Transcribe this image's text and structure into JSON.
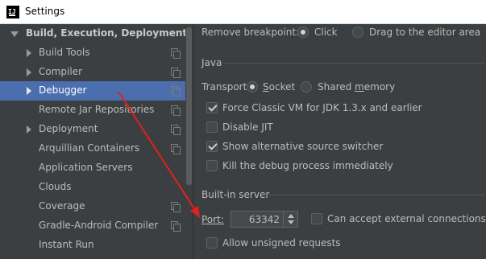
{
  "window": {
    "title": "Settings",
    "app_icon": "intellij-icon"
  },
  "sidebar": {
    "items": [
      {
        "label": "Build, Execution, Deployment",
        "expander": "expanded",
        "copy": false,
        "selected": false
      },
      {
        "label": "Build Tools",
        "expander": "collapsed",
        "copy": true,
        "selected": false
      },
      {
        "label": "Compiler",
        "expander": "collapsed",
        "copy": true,
        "selected": false
      },
      {
        "label": "Debugger",
        "expander": "collapsed",
        "copy": true,
        "selected": true
      },
      {
        "label": "Remote Jar Repositories",
        "expander": "none",
        "copy": true,
        "selected": false
      },
      {
        "label": "Deployment",
        "expander": "collapsed",
        "copy": true,
        "selected": false
      },
      {
        "label": "Arquillian Containers",
        "expander": "none",
        "copy": true,
        "selected": false
      },
      {
        "label": "Application Servers",
        "expander": "none",
        "copy": false,
        "selected": false
      },
      {
        "label": "Clouds",
        "expander": "none",
        "copy": false,
        "selected": false
      },
      {
        "label": "Coverage",
        "expander": "none",
        "copy": true,
        "selected": false
      },
      {
        "label": "Gradle-Android Compiler",
        "expander": "none",
        "copy": true,
        "selected": false
      },
      {
        "label": "Instant Run",
        "expander": "none",
        "copy": false,
        "selected": false
      }
    ]
  },
  "remove_breakpoint": {
    "label": "Remove breakpoint:",
    "options": [
      {
        "label": "Click",
        "selected": true
      },
      {
        "label": "Drag to the editor area",
        "selected": false
      }
    ]
  },
  "java": {
    "section_title": "Java",
    "transport_label": "Transport:",
    "transport_options": [
      {
        "label": "Socket",
        "mnemonic": "S",
        "rest": "ocket",
        "selected": true
      },
      {
        "label": "Shared memory",
        "prefix": "Shared ",
        "mnemonic": "m",
        "rest": "emory",
        "selected": false
      }
    ],
    "checkboxes": [
      {
        "label": "Force Classic VM for JDK 1.3.x and earlier",
        "checked": true
      },
      {
        "label": "Disable JIT",
        "checked": false
      },
      {
        "label": "Show alternative source switcher",
        "checked": true
      },
      {
        "label": "Kill the debug process immediately",
        "checked": false
      }
    ]
  },
  "builtin_server": {
    "section_title": "Built-in server",
    "port_label": "Port:",
    "port_value": "63342",
    "external_label": "Can accept external connections",
    "external_checked": false,
    "unsigned_label": "Allow unsigned requests",
    "unsigned_checked": false
  },
  "colors": {
    "selection": "#4b6eaf",
    "annotation_arrow": "#e02020",
    "background": "#3c3f41"
  }
}
